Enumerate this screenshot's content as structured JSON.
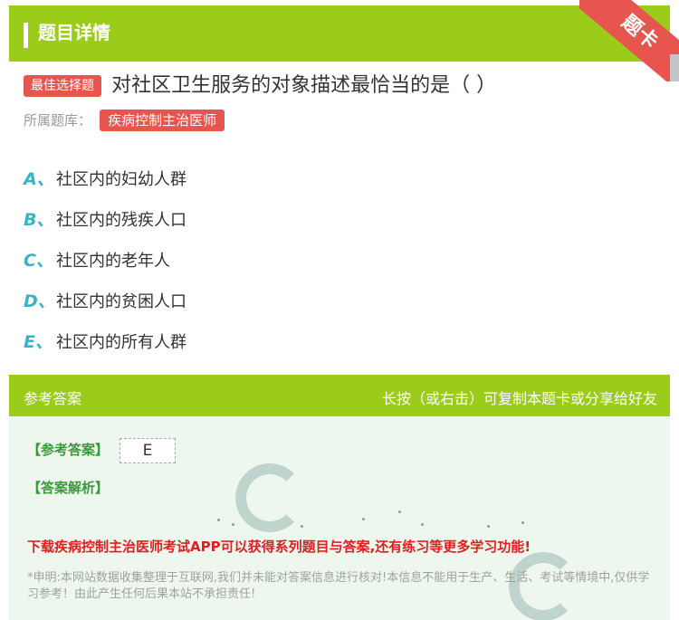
{
  "header": {
    "title": "题目详情",
    "ribbon": "题卡"
  },
  "question": {
    "badge": "最佳选择题",
    "text": "对社区卫生服务的对象描述最恰当的是（ ）",
    "source_label": "所属题库：",
    "source_value": "疾病控制主治医师"
  },
  "options": [
    {
      "letter": "A、",
      "text": "社区内的妇幼人群"
    },
    {
      "letter": "B、",
      "text": "社区内的残疾人口"
    },
    {
      "letter": "C、",
      "text": "社区内的老年人"
    },
    {
      "letter": "D、",
      "text": "社区内的贫困人口"
    },
    {
      "letter": "E、",
      "text": "社区内的所有人群"
    }
  ],
  "answer": {
    "head_left": "参考答案",
    "head_right": "长按（或右击）可复制本题卡或分享给好友",
    "key_label": "【参考答案】",
    "key_value": "E",
    "expl_label": "【答案解析】",
    "promo": "下载疾病控制主治医师考试APP可以获得系列题目与答案,还有练习等更多学习功能!",
    "disclaimer": "*申明:本网站数据收集整理于互联网,我们并未能对答案信息进行核对!本信息不能用于生产、生活、考试等情境中,仅供学习参考！由此产生任何后果本站不承担责任!"
  },
  "colors": {
    "green": "#9ccc1a",
    "red": "#e8554e",
    "teal": "#35b5c6"
  }
}
